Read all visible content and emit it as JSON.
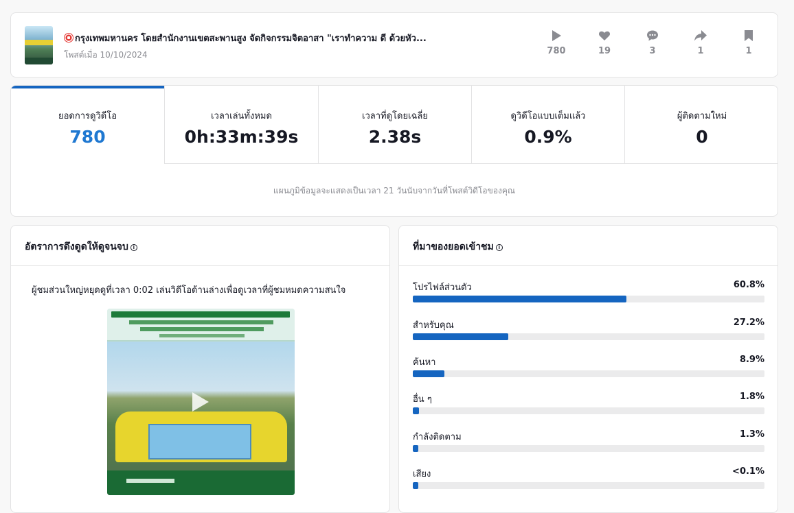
{
  "post": {
    "title": "กรุงเทพมหานคร โดยสำนักงานเขตสะพานสูง จัดกิจกรรมจิตอาสา \"เราทำความ ดี ด้วยหัว...",
    "date": "โพสต์เมื่อ 10/10/2024",
    "stats": [
      {
        "icon": "play-icon",
        "value": "780"
      },
      {
        "icon": "heart-icon",
        "value": "19"
      },
      {
        "icon": "comment-icon",
        "value": "3"
      },
      {
        "icon": "share-icon",
        "value": "1"
      },
      {
        "icon": "bookmark-icon",
        "value": "1"
      }
    ]
  },
  "metrics": {
    "tabs": [
      {
        "label": "ยอดการดูวิดีโอ",
        "value": "780"
      },
      {
        "label": "เวลาเล่นทั้งหมด",
        "value": "0h:33m:39s"
      },
      {
        "label": "เวลาที่ดูโดยเฉลี่ย",
        "value": "2.38s"
      },
      {
        "label": "ดูวิดีโอแบบเต็มแล้ว",
        "value": "0.9%"
      },
      {
        "label": "ผู้ติดตามใหม่",
        "value": "0"
      }
    ],
    "note": "แผนภูมิข้อมูลจะแสดงเป็นเวลา 21 วันนับจากวันที่โพสต์วิดีโอของคุณ"
  },
  "retention": {
    "title": "อัตราการดึงดูดให้ดูจนจบ",
    "description": "ผู้ชมส่วนใหญ่หยุดดูที่เวลา 0:02 เล่นวิดีโอด้านล่างเพื่อดูเวลาที่ผู้ชมหมดความสนใจ"
  },
  "sources": {
    "title": "ที่มาของยอดเข้าชม",
    "items": [
      {
        "label": "โปรไฟล์ส่วนตัว",
        "value": "60.8%",
        "fraction": 0.608
      },
      {
        "label": "สำหรับคุณ",
        "value": "27.2%",
        "fraction": 0.272
      },
      {
        "label": "ค้นหา",
        "value": "8.9%",
        "fraction": 0.089
      },
      {
        "label": "อื่น ๆ",
        "value": "1.8%",
        "fraction": 0.018
      },
      {
        "label": "กำลังติดตาม",
        "value": "1.3%",
        "fraction": 0.013
      },
      {
        "label": "เสียง",
        "value": "<0.1%",
        "fraction": 0.001
      }
    ]
  },
  "colors": {
    "accent": "#1565c0",
    "value_accent": "#1f78d1",
    "muted": "#8a8b91"
  }
}
